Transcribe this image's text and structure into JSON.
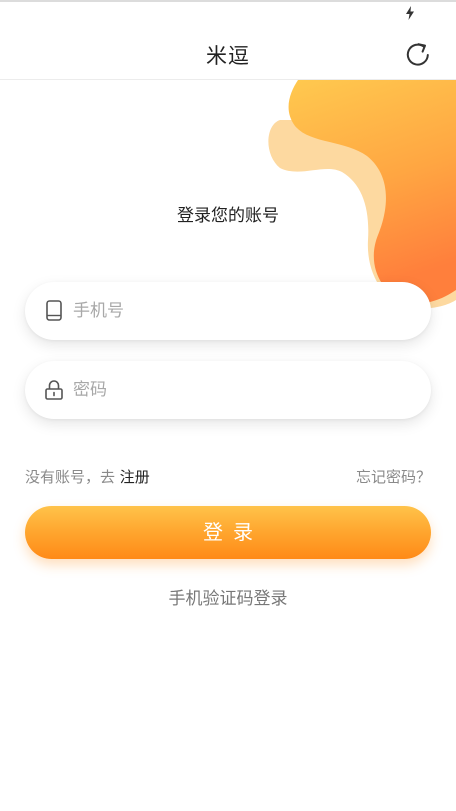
{
  "header": {
    "title": "米逗"
  },
  "login": {
    "heading": "登录您的账号",
    "phone_placeholder": "手机号",
    "password_placeholder": "密码",
    "no_account_text": "没有账号，去 ",
    "register_link": "注册",
    "forgot_password": "忘记密码？",
    "login_button": "登录",
    "sms_login_link": "手机验证码登录"
  },
  "icons": {
    "status": "charging-bolt-icon",
    "refresh": "refresh-icon",
    "phone": "phone-icon",
    "lock": "lock-icon"
  },
  "colors": {
    "accent": "#ff9a22",
    "accent_light": "#ffc34a",
    "deco_light": "#fdd9a0",
    "text_primary": "#222222",
    "text_secondary": "#8a8a8a",
    "placeholder": "#a8a8a8"
  }
}
